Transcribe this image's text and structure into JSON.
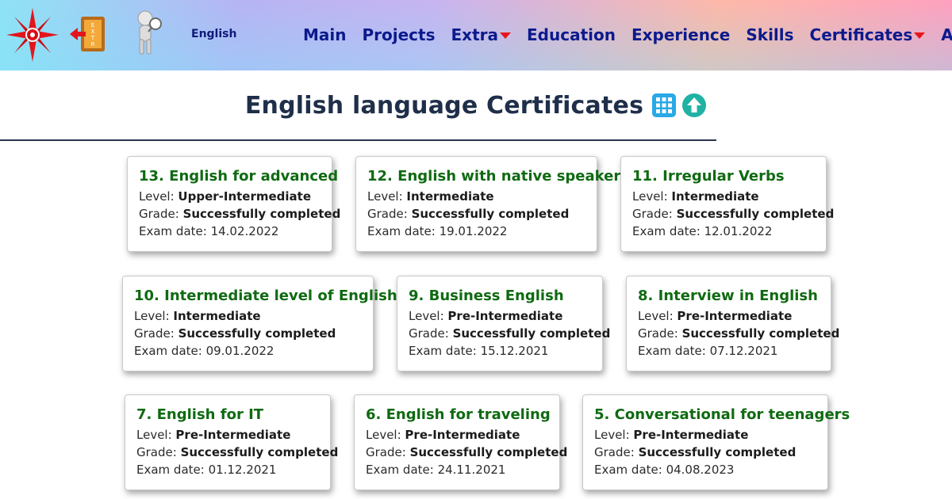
{
  "header": {
    "language": "English",
    "nav": [
      {
        "label": "Main",
        "dropdown": false
      },
      {
        "label": "Projects",
        "dropdown": false
      },
      {
        "label": "Extra",
        "dropdown": true
      },
      {
        "label": "Education",
        "dropdown": false
      },
      {
        "label": "Experience",
        "dropdown": false
      },
      {
        "label": "Skills",
        "dropdown": false
      },
      {
        "label": "Certificates",
        "dropdown": true
      },
      {
        "label": "About",
        "dropdown": false
      }
    ],
    "extra_badge": "EXTRA"
  },
  "main": {
    "title": "English language Certificates",
    "labels": {
      "level": "Level: ",
      "grade": "Grade: ",
      "exam_date": "Exam date: "
    },
    "certificates": [
      {
        "title": "13. English for advanced",
        "level": "Upper-Intermediate",
        "grade": "Successfully completed",
        "exam_date": "14.02.2022"
      },
      {
        "title": "12. English with native speaker",
        "level": "Intermediate",
        "grade": "Successfully completed",
        "exam_date": "19.01.2022"
      },
      {
        "title": "11. Irregular Verbs",
        "level": "Intermediate",
        "grade": "Successfully completed",
        "exam_date": "12.01.2022"
      },
      {
        "title": "10. Intermediate level of English",
        "level": "Intermediate",
        "grade": "Successfully completed",
        "exam_date": "09.01.2022"
      },
      {
        "title": "9. Business English",
        "level": "Pre-Intermediate",
        "grade": "Successfully completed",
        "exam_date": "15.12.2021"
      },
      {
        "title": "8. Interview in English",
        "level": "Pre-Intermediate",
        "grade": "Successfully completed",
        "exam_date": "07.12.2021"
      },
      {
        "title": "7. English for IT",
        "level": "Pre-Intermediate",
        "grade": "Successfully completed",
        "exam_date": "01.12.2021"
      },
      {
        "title": "6. English for traveling",
        "level": "Pre-Intermediate",
        "grade": "Successfully completed",
        "exam_date": "24.11.2021"
      },
      {
        "title": "5. Conversational for teenagers",
        "level": "Pre-Intermediate",
        "grade": "Successfully completed",
        "exam_date": "04.08.2023"
      }
    ]
  },
  "icons": {
    "logo": "compass-star-icon",
    "extra": "exit-door-icon",
    "figure": "magnifier-figure-icon",
    "grid": "grid-view-icon",
    "up": "arrow-up-circle-icon"
  },
  "colors": {
    "nav_text": "#0b1a8c",
    "card_title": "#0f6a12",
    "caret": "#e8141b",
    "grid_icon": "#29a9e6",
    "up_icon": "#20b2a4"
  }
}
